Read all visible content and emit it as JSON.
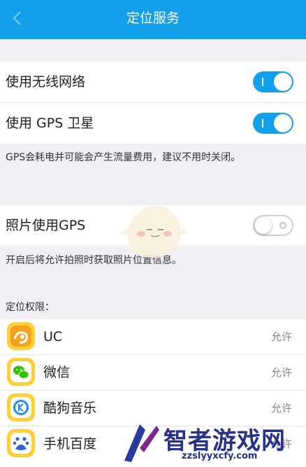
{
  "header": {
    "title": "定位服务",
    "back_icon": "chevron-left-icon"
  },
  "settings": {
    "wifi_label": "使用无线网络",
    "wifi_on": true,
    "gps_label": "使用 GPS 卫星",
    "gps_on": true,
    "gps_note": "GPS会耗电并可能会产生流量费用，建议不用时关闭。",
    "photo_gps_label": "照片使用GPS",
    "photo_gps_on": false,
    "photo_note": "开启后将允许拍照时获取照片位置信息。"
  },
  "permissions": {
    "section_label": "定位权限：",
    "apps": [
      {
        "name": "UC",
        "status": "允许",
        "icon": "uc-browser-icon"
      },
      {
        "name": "微信",
        "status": "允许",
        "icon": "wechat-icon"
      },
      {
        "name": "酷狗音乐",
        "status": "允许",
        "icon": "kugou-music-icon"
      },
      {
        "name": "手机百度",
        "status": "允许",
        "icon": "baidu-icon"
      }
    ]
  },
  "watermark": {
    "text": "智者游戏网",
    "url": "zzslyyxcfy.com"
  },
  "colors": {
    "accent": "#12a0ea",
    "background": "#efeff4",
    "icon_bg": "#ffcf3a"
  }
}
